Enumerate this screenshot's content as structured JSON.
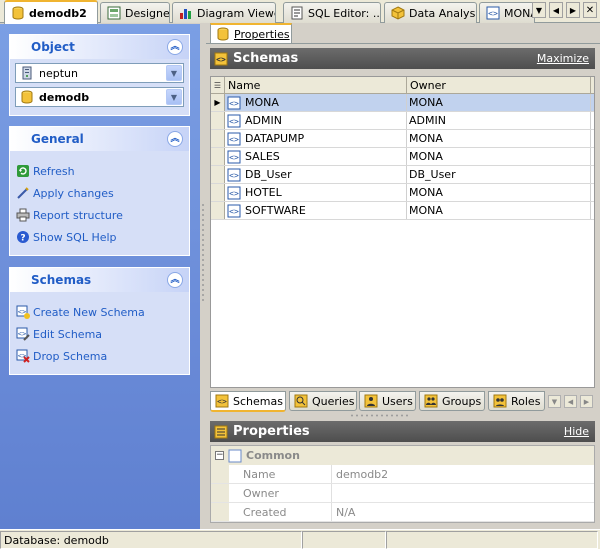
{
  "tabs": [
    {
      "label": "demodb2",
      "icon": "database-icon"
    },
    {
      "label": "Designer",
      "icon": "designer-icon"
    },
    {
      "label": "Diagram Viewer",
      "icon": "chart-icon"
    },
    {
      "label": "SQL Editor: ...",
      "icon": "sql-icon"
    },
    {
      "label": "Data Analysis",
      "icon": "cube-icon"
    },
    {
      "label": "MONA",
      "icon": "schema-icon"
    }
  ],
  "nav": {
    "object": {
      "title": "Object",
      "server": "neptun",
      "database": "demodb"
    },
    "general": {
      "title": "General",
      "items": [
        {
          "label": "Refresh",
          "icon": "refresh-icon"
        },
        {
          "label": "Apply changes",
          "icon": "apply-changes-icon"
        },
        {
          "label": "Report structure",
          "icon": "printer-icon"
        },
        {
          "label": "Show SQL Help",
          "icon": "help-icon"
        }
      ]
    },
    "schemas": {
      "title": "Schemas",
      "items": [
        {
          "label": "Create New Schema",
          "icon": "create-schema-icon"
        },
        {
          "label": "Edit Schema",
          "icon": "edit-schema-icon"
        },
        {
          "label": "Drop Schema",
          "icon": "drop-schema-icon"
        }
      ]
    }
  },
  "inner_tab": "Properties",
  "schemas_panel": {
    "title": "Schemas",
    "maximize": "Maximize",
    "columns": [
      "Name",
      "Owner"
    ],
    "rows": [
      {
        "name": "MONA",
        "owner": "MONA"
      },
      {
        "name": "ADMIN",
        "owner": "ADMIN"
      },
      {
        "name": "DATAPUMP",
        "owner": "MONA"
      },
      {
        "name": "SALES",
        "owner": "MONA"
      },
      {
        "name": "DB_User",
        "owner": "DB_User"
      },
      {
        "name": "HOTEL",
        "owner": "MONA"
      },
      {
        "name": "SOFTWARE",
        "owner": "MONA"
      }
    ]
  },
  "bottom_tabs": [
    "Schemas",
    "Queries",
    "Users",
    "Groups",
    "Roles"
  ],
  "properties_panel": {
    "title": "Properties",
    "hide": "Hide",
    "category": "Common",
    "rows": [
      {
        "key": "Name",
        "value": "demodb2"
      },
      {
        "key": "Owner",
        "value": ""
      },
      {
        "key": "Created",
        "value": "N/A"
      }
    ]
  },
  "status": {
    "text": "Database: demodb"
  }
}
